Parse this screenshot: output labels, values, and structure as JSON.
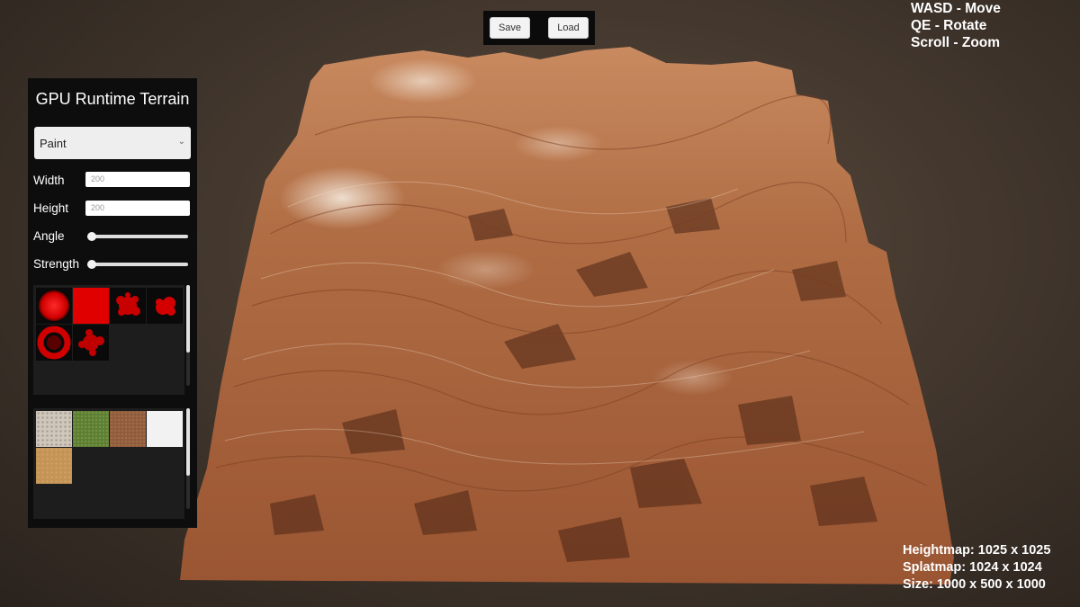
{
  "toolbar": {
    "save_label": "Save",
    "load_label": "Load"
  },
  "controls": [
    "WASD - Move",
    "QE - Rotate",
    "Scroll - Zoom"
  ],
  "info": {
    "heightmap": "Heightmap: 1025 x 1025",
    "splatmap": "Splatmap: 1024 x 1024",
    "size": "Size: 1000 x 500 x 1000"
  },
  "panel": {
    "title": "GPU Runtime Terrain",
    "mode": "Paint",
    "width_label": "Width",
    "width_value": "200",
    "height_label": "Height",
    "height_value": "200",
    "angle_label": "Angle",
    "angle_value": 0,
    "strength_label": "Strength",
    "strength_value": 0,
    "brushes": [
      "brush-soft-circle-icon",
      "brush-square-icon",
      "brush-splatter-icon",
      "brush-cloud-icon",
      "brush-ring-icon",
      "brush-scatter-icon"
    ],
    "textures": [
      "texture-gravel",
      "texture-grass",
      "texture-dirt",
      "texture-snow",
      "texture-sand"
    ]
  },
  "colors": {
    "panel_bg": "#0d0d0d",
    "brush_red": "#e00000",
    "terrain_base": "#a8643c",
    "terrain_highlight": "#f1e3d2",
    "terrain_shadow": "#3a1c10"
  }
}
